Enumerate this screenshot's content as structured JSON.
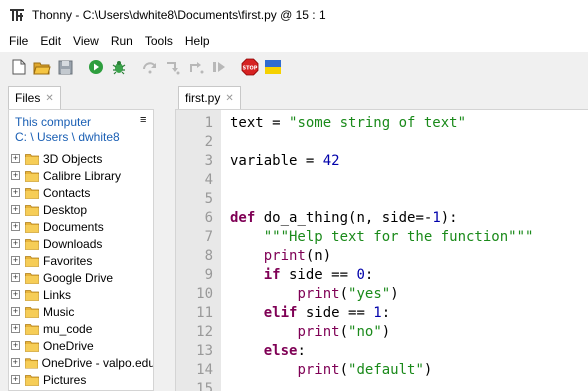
{
  "window": {
    "title": "Thonny  -  C:\\Users\\dwhite8\\Documents\\first.py  @  15 : 1"
  },
  "menu": {
    "items": [
      "File",
      "Edit",
      "View",
      "Run",
      "Tools",
      "Help"
    ]
  },
  "toolbar": {
    "buttons": [
      "new-file-icon",
      "open-file-icon",
      "save-icon",
      "run-icon",
      "debug-icon",
      "step-over-icon",
      "step-into-icon",
      "step-out-icon",
      "resume-icon",
      "stop-icon",
      "ukraine-flag-icon"
    ],
    "stop_label": "STOP"
  },
  "files": {
    "tab_label": "Files",
    "location_title": "This computer",
    "breadcrumb": "C: \\ Users \\ dwhite8",
    "items": [
      "3D Objects",
      "Calibre Library",
      "Contacts",
      "Desktop",
      "Documents",
      "Downloads",
      "Favorites",
      "Google Drive",
      "Links",
      "Music",
      "mu_code",
      "OneDrive",
      "OneDrive - valpo.edu",
      "Pictures"
    ],
    "expander_glyph": "+"
  },
  "editor": {
    "tab_label": "first.py",
    "lines": [
      {
        "n": "1",
        "text": "text = \"some string of text\""
      },
      {
        "n": "2",
        "text": ""
      },
      {
        "n": "3",
        "text": "variable = 42"
      },
      {
        "n": "4",
        "text": ""
      },
      {
        "n": "5",
        "text": ""
      },
      {
        "n": "6",
        "text": "def do_a_thing(n, side=-1):"
      },
      {
        "n": "7",
        "text": "    \"\"\"Help text for the function\"\"\""
      },
      {
        "n": "8",
        "text": "    print(n)"
      },
      {
        "n": "9",
        "text": "    if side == 0:"
      },
      {
        "n": "10",
        "text": "        print(\"yes\")"
      },
      {
        "n": "11",
        "text": "    elif side == 1:"
      },
      {
        "n": "12",
        "text": "        print(\"no\")"
      },
      {
        "n": "13",
        "text": "    else:"
      },
      {
        "n": "14",
        "text": "        print(\"default\")"
      },
      {
        "n": "15",
        "text": ""
      }
    ]
  },
  "colors": {
    "keyword": "#7f0055",
    "string": "#1a8a1a",
    "number": "#0000aa",
    "link": "#1a5fb4"
  }
}
